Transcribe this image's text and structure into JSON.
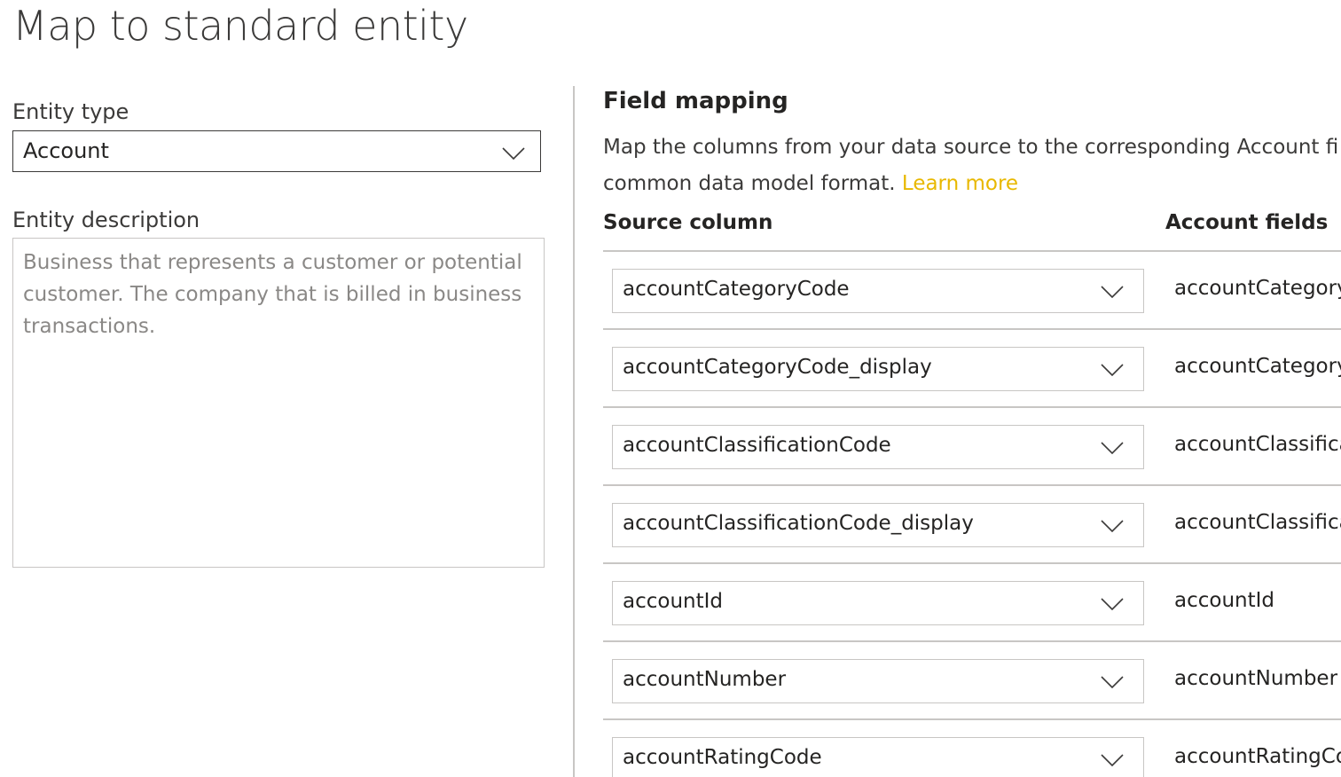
{
  "page": {
    "title": "Map to standard entity"
  },
  "entity": {
    "type_label": "Entity type",
    "type_value": "Account",
    "description_label": "Entity description",
    "description_text": "Business that represents a customer or potential customer. The company that is billed in business transactions."
  },
  "field_mapping": {
    "heading": "Field mapping",
    "description": "Map the columns from your data source to the corresponding Account fi",
    "description_line2": "common data model format.",
    "learn_more": "Learn more",
    "source_column_header": "Source column",
    "target_column_header": "Account fields",
    "rows": [
      {
        "source": "accountCategoryCode",
        "target": "accountCategory"
      },
      {
        "source": "accountCategoryCode_display",
        "target": "accountCategory"
      },
      {
        "source": "accountClassificationCode",
        "target": "accountClassifica"
      },
      {
        "source": "accountClassificationCode_display",
        "target": "accountClassifica"
      },
      {
        "source": "accountId",
        "target": "accountId"
      },
      {
        "source": "accountNumber",
        "target": "accountNumber"
      },
      {
        "source": "accountRatingCode",
        "target": "accountRatingCo"
      }
    ]
  },
  "icons": {
    "dropdown": "chevron-down-icon"
  },
  "colors": {
    "link": "#e8b800",
    "border_strong": "#3b3a39",
    "border_light": "#c8c6c4",
    "placeholder_text": "#8a8886"
  }
}
